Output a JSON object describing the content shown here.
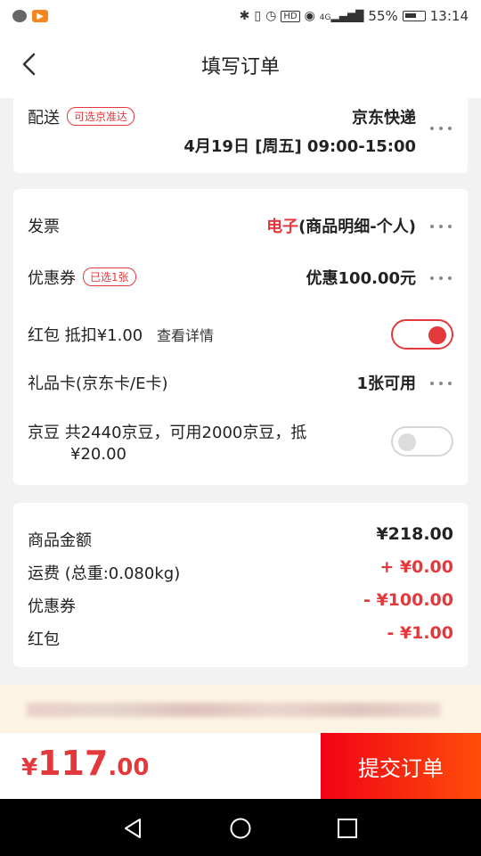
{
  "status_bar": {
    "battery": "55%",
    "time": "13:14",
    "icons": [
      "wechat-icon",
      "app-icon",
      "bluetooth-icon",
      "vibrate-icon",
      "alarm-icon",
      "hd-icon",
      "eye-icon",
      "signal-icon",
      "battery-icon"
    ],
    "hd_label": "HD",
    "network_label": "4G"
  },
  "header": {
    "title": "填写订单"
  },
  "delivery": {
    "label": "配送",
    "tag": "可选京准达",
    "carrier": "京东快递",
    "time": "4月19日 [周五] 09:00-15:00"
  },
  "options": {
    "invoice": {
      "label": "发票",
      "value_type": "电子",
      "value_detail": "(商品明细-个人)"
    },
    "coupon": {
      "label": "优惠券",
      "tag": "已选1张",
      "value": "优惠100.00元"
    },
    "redpacket": {
      "label": "红包",
      "deduct": "抵扣¥1.00",
      "link": "查看详情",
      "enabled": true
    },
    "giftcard": {
      "label": "礼品卡(京东卡/E卡)",
      "value": "1张可用"
    },
    "jingdou": {
      "label": "京豆",
      "line1": "共2440京豆，可用2000京豆，抵",
      "line2": "¥20.00",
      "enabled": false
    }
  },
  "summary": {
    "items": [
      {
        "label": "商品金额",
        "value": "¥218.00"
      },
      {
        "label": "运费 (总重:0.080kg)",
        "value": "+ ¥0.00"
      },
      {
        "label": "优惠券",
        "value": "- ¥100.00"
      },
      {
        "label": "红包",
        "value": "- ¥1.00"
      }
    ]
  },
  "bottom": {
    "currency": "¥",
    "total_int": "117",
    "total_dec": ".00",
    "submit_label": "提交订单"
  },
  "colors": {
    "accent": "#e4393c",
    "submit_start": "#f10215",
    "submit_end": "#ff4d0a"
  }
}
